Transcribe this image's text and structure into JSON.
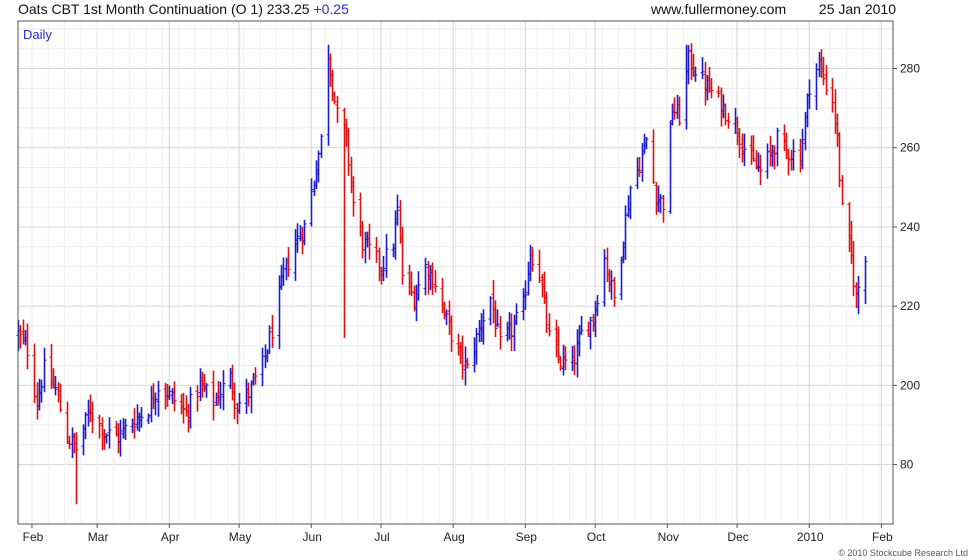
{
  "header": {
    "title": "Oats CBT 1st Month Continuation (O 1) 233.25",
    "change": "+0.25",
    "site": "www.fullermoney.com",
    "date": "25 Jan 2010"
  },
  "copyright": "© 2010 Stockcube Research Ltd",
  "colors": {
    "up": "#1a1ad8",
    "down": "#e01010",
    "grid": "#d4d4d4",
    "period_label": "#2a2ad8"
  },
  "chart_data": {
    "type": "ohlc",
    "period_label": "Daily",
    "ylim": [
      165,
      292
    ],
    "ytick_values": [
      180,
      200,
      220,
      240,
      260,
      280
    ],
    "ytick_labels": [
      "80",
      "200",
      "220",
      "240",
      "260",
      "280"
    ],
    "xtick_labels": [
      "Feb",
      "Mar",
      "Apr",
      "May",
      "Jun",
      "Jul",
      "Aug",
      "Sep",
      "Oct",
      "Nov",
      "Dec",
      "2010",
      "Feb"
    ],
    "xtick_dates": [
      "2009-02-01",
      "2009-03-01",
      "2009-04-01",
      "2009-05-01",
      "2009-06-01",
      "2009-07-01",
      "2009-08-01",
      "2009-09-01",
      "2009-10-01",
      "2009-11-01",
      "2009-12-01",
      "2010-01-01",
      "2010-02-01"
    ],
    "xlim": [
      "2009-01-26",
      "2010-02-06"
    ],
    "close_anchors": [
      [
        "2009-01-26",
        213
      ],
      [
        "2009-01-30",
        209
      ],
      [
        "2009-02-03",
        196
      ],
      [
        "2009-02-06",
        204
      ],
      [
        "2009-02-11",
        199
      ],
      [
        "2009-02-16",
        187
      ],
      [
        "2009-02-20",
        184
      ],
      [
        "2009-02-26",
        194
      ],
      [
        "2009-03-04",
        188
      ],
      [
        "2009-03-10",
        187
      ],
      [
        "2009-03-16",
        191
      ],
      [
        "2009-03-23",
        194
      ],
      [
        "2009-03-27",
        200
      ],
      [
        "2009-04-02",
        197
      ],
      [
        "2009-04-08",
        193
      ],
      [
        "2009-04-14",
        200
      ],
      [
        "2009-04-20",
        196
      ],
      [
        "2009-04-27",
        202
      ],
      [
        "2009-04-30",
        195
      ],
      [
        "2009-05-05",
        198
      ],
      [
        "2009-05-11",
        205
      ],
      [
        "2009-05-15",
        214
      ],
      [
        "2009-05-20",
        228
      ],
      [
        "2009-05-25",
        236
      ],
      [
        "2009-05-29",
        240
      ],
      [
        "2009-06-02",
        252
      ],
      [
        "2009-06-05",
        262
      ],
      [
        "2009-06-08",
        284
      ],
      [
        "2009-06-10",
        276
      ],
      [
        "2009-06-12",
        268
      ],
      [
        "2009-06-16",
        262
      ],
      [
        "2009-06-19",
        246
      ],
      [
        "2009-06-23",
        236
      ],
      [
        "2009-06-26",
        234
      ],
      [
        "2009-07-01",
        230
      ],
      [
        "2009-07-06",
        236
      ],
      [
        "2009-07-08",
        244
      ],
      [
        "2009-07-10",
        228
      ],
      [
        "2009-07-15",
        222
      ],
      [
        "2009-07-20",
        230
      ],
      [
        "2009-07-24",
        226
      ],
      [
        "2009-07-28",
        218
      ],
      [
        "2009-08-03",
        208
      ],
      [
        "2009-08-07",
        204
      ],
      [
        "2009-08-12",
        214
      ],
      [
        "2009-08-17",
        222
      ],
      [
        "2009-08-21",
        210
      ],
      [
        "2009-08-26",
        214
      ],
      [
        "2009-08-31",
        220
      ],
      [
        "2009-09-03",
        234
      ],
      [
        "2009-09-07",
        228
      ],
      [
        "2009-09-11",
        212
      ],
      [
        "2009-09-16",
        206
      ],
      [
        "2009-09-21",
        205
      ],
      [
        "2009-09-25",
        213
      ],
      [
        "2009-09-30",
        217
      ],
      [
        "2009-10-05",
        232
      ],
      [
        "2009-10-09",
        222
      ],
      [
        "2009-10-13",
        238
      ],
      [
        "2009-10-16",
        250
      ],
      [
        "2009-10-20",
        256
      ],
      [
        "2009-10-23",
        262
      ],
      [
        "2009-10-27",
        248
      ],
      [
        "2009-10-30",
        246
      ],
      [
        "2009-11-03",
        270
      ],
      [
        "2009-11-06",
        268
      ],
      [
        "2009-11-10",
        282
      ],
      [
        "2009-11-13",
        280
      ],
      [
        "2009-11-17",
        276
      ],
      [
        "2009-11-20",
        274
      ],
      [
        "2009-11-25",
        270
      ],
      [
        "2009-11-30",
        266
      ],
      [
        "2009-12-04",
        260
      ],
      [
        "2009-12-08",
        256
      ],
      [
        "2009-12-11",
        254
      ],
      [
        "2009-12-15",
        258
      ],
      [
        "2009-12-18",
        262
      ],
      [
        "2009-12-22",
        259
      ],
      [
        "2009-12-28",
        258
      ],
      [
        "2010-01-01",
        276
      ],
      [
        "2010-01-05",
        281
      ],
      [
        "2010-01-08",
        276
      ],
      [
        "2010-01-11",
        272
      ],
      [
        "2010-01-13",
        262
      ],
      [
        "2010-01-15",
        244
      ],
      [
        "2010-01-19",
        232
      ],
      [
        "2010-01-21",
        222
      ],
      [
        "2010-01-23",
        228
      ],
      [
        "2010-01-25",
        233.25
      ]
    ],
    "lows": [
      [
        "2009-02-20",
        170
      ],
      [
        "2009-06-15",
        212
      ],
      [
        "2010-01-22",
        218
      ]
    ],
    "highs": [
      [
        "2009-06-08",
        286
      ],
      [
        "2009-11-09",
        286
      ]
    ]
  }
}
